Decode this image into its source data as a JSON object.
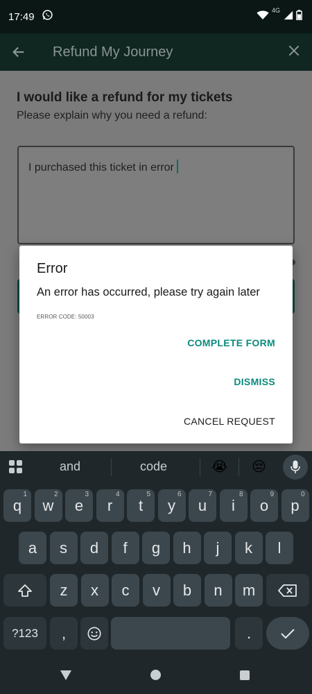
{
  "status_bar": {
    "time": "17:49",
    "network_label": "4G"
  },
  "app_bar": {
    "title": "Refund My Journey"
  },
  "page": {
    "heading": "I would like a refund for my tickets",
    "subheading": "Please explain why you need a refund:",
    "reason_text": "I purchased this ticket in error"
  },
  "dialog": {
    "title": "Error",
    "message": "An error has occurred, please try again later",
    "error_code": "ERROR CODE: 50003",
    "complete_label": "COMPLETE FORM",
    "dismiss_label": "DISMISS",
    "cancel_label": "CANCEL REQUEST"
  },
  "keyboard": {
    "suggestions": [
      "and",
      "code"
    ],
    "emoji_suggestions": [
      "😭",
      "😔"
    ],
    "row1": [
      {
        "k": "q",
        "n": "1"
      },
      {
        "k": "w",
        "n": "2"
      },
      {
        "k": "e",
        "n": "3"
      },
      {
        "k": "r",
        "n": "4"
      },
      {
        "k": "t",
        "n": "5"
      },
      {
        "k": "y",
        "n": "6"
      },
      {
        "k": "u",
        "n": "7"
      },
      {
        "k": "i",
        "n": "8"
      },
      {
        "k": "o",
        "n": "9"
      },
      {
        "k": "p",
        "n": "0"
      }
    ],
    "row2": [
      "a",
      "s",
      "d",
      "f",
      "g",
      "h",
      "j",
      "k",
      "l"
    ],
    "row3": [
      "z",
      "x",
      "c",
      "v",
      "b",
      "n",
      "m"
    ],
    "symbols_label": "?123",
    "comma": ",",
    "period": "."
  },
  "colors": {
    "accent": "#0b8a7c",
    "app_bar": "#0f2621",
    "keyboard_bg": "#1f272b"
  }
}
